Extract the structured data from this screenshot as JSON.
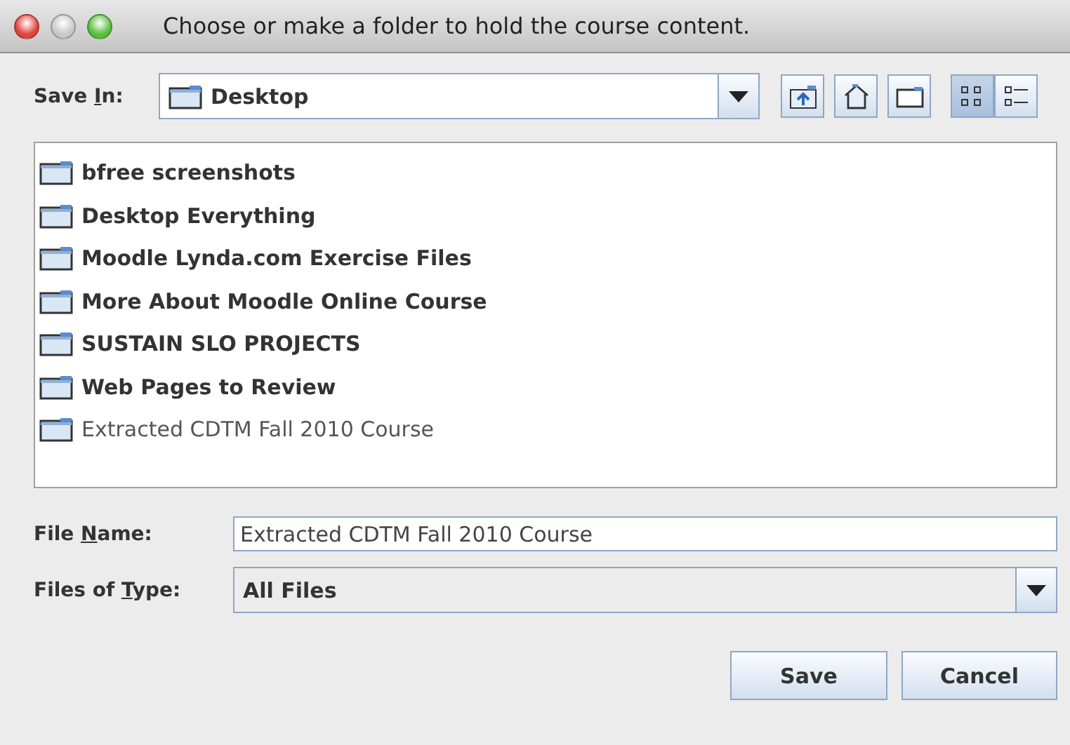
{
  "window": {
    "title": "Choose or make a folder to hold the course content."
  },
  "save_in": {
    "label": {
      "before": "Save ",
      "key": "I",
      "after": "n:"
    },
    "value": "Desktop"
  },
  "toolbar": [
    {
      "kind": "up"
    },
    {
      "kind": "home"
    },
    {
      "kind": "new-folder"
    }
  ],
  "view_toggle": [
    {
      "kind": "list",
      "selected": true
    },
    {
      "kind": "details",
      "selected": false
    }
  ],
  "files": [
    {
      "name": "bfree screenshots",
      "kind": "folder"
    },
    {
      "name": "Desktop Everything",
      "kind": "folder"
    },
    {
      "name": "Moodle Lynda.com Exercise Files",
      "kind": "folder"
    },
    {
      "name": "More About Moodle Online Course",
      "kind": "folder"
    },
    {
      "name": "SUSTAIN SLO PROJECTS",
      "kind": "folder"
    },
    {
      "name": "Web Pages to Review",
      "kind": "folder"
    },
    {
      "name": "Extracted CDTM Fall 2010 Course",
      "kind": "plain"
    }
  ],
  "file_name": {
    "label": {
      "before": "File ",
      "key": "N",
      "after": "ame:"
    },
    "value": "Extracted CDTM Fall 2010 Course"
  },
  "file_type": {
    "label": {
      "before": "Files of ",
      "key": "T",
      "after": "ype:"
    },
    "value": "All Files"
  },
  "buttons": [
    "Save",
    "Cancel"
  ]
}
